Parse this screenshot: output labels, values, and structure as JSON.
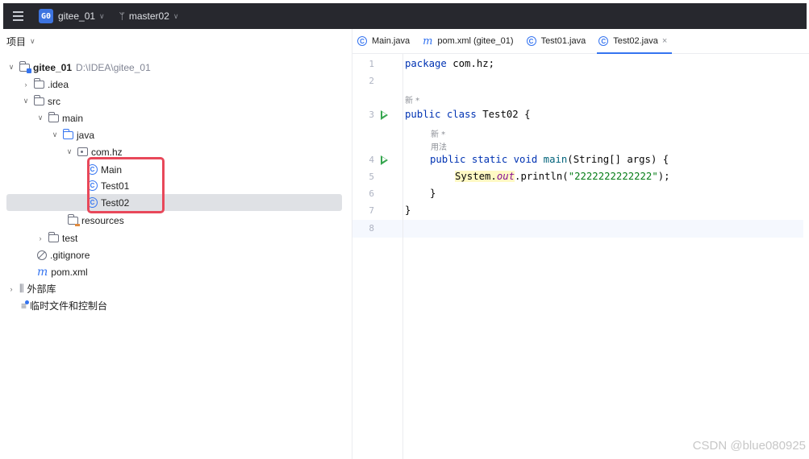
{
  "titlebar": {
    "project_badge": "G0",
    "project_name": "gitee_01",
    "branch_name": "master02"
  },
  "project_panel": {
    "header": "项目",
    "tree": {
      "root_name": "gitee_01",
      "root_path": "D:\\IDEA\\gitee_01",
      "idea": ".idea",
      "src": "src",
      "main": "main",
      "java": "java",
      "package": "com.hz",
      "class_main": "Main",
      "class_test01": "Test01",
      "class_test02": "Test02",
      "resources": "resources",
      "test": "test",
      "gitignore": ".gitignore",
      "pom": "pom.xml",
      "external_libs": "外部库",
      "scratches": "临时文件和控制台"
    }
  },
  "editor": {
    "tabs": [
      {
        "label": "Main.java",
        "icon": "class-icon"
      },
      {
        "label": "pom.xml (gitee_01)",
        "icon": "maven-icon"
      },
      {
        "label": "Test01.java",
        "icon": "class-icon"
      },
      {
        "label": "Test02.java",
        "icon": "class-icon",
        "active": true
      }
    ],
    "line_numbers": [
      "1",
      "2",
      "3",
      "4",
      "5",
      "6",
      "7",
      "8"
    ],
    "hints": {
      "class_hint": "新 *",
      "method_hint_1": "新 *",
      "method_hint_2": "用法"
    },
    "code": {
      "l1_kw": "package",
      "l1_rest": " com.hz;",
      "l3_kw": "public class",
      "l3_rest": " Test02 {",
      "l4_kw": "public static void",
      "l4_fn": "main",
      "l4_rest": "(String[] args) {",
      "l5_sys": "System.",
      "l5_field": "out",
      "l5_mid": ".println(",
      "l5_str": "\"2222222222222\"",
      "l5_end": ");",
      "l6": "}",
      "l7": "}"
    }
  },
  "watermark": "CSDN @blue080925",
  "colors": {
    "titlebar_bg": "#27282e",
    "accent": "#3574f0",
    "highlight_box": "#e8485a",
    "run_icon": "#36a64f"
  }
}
